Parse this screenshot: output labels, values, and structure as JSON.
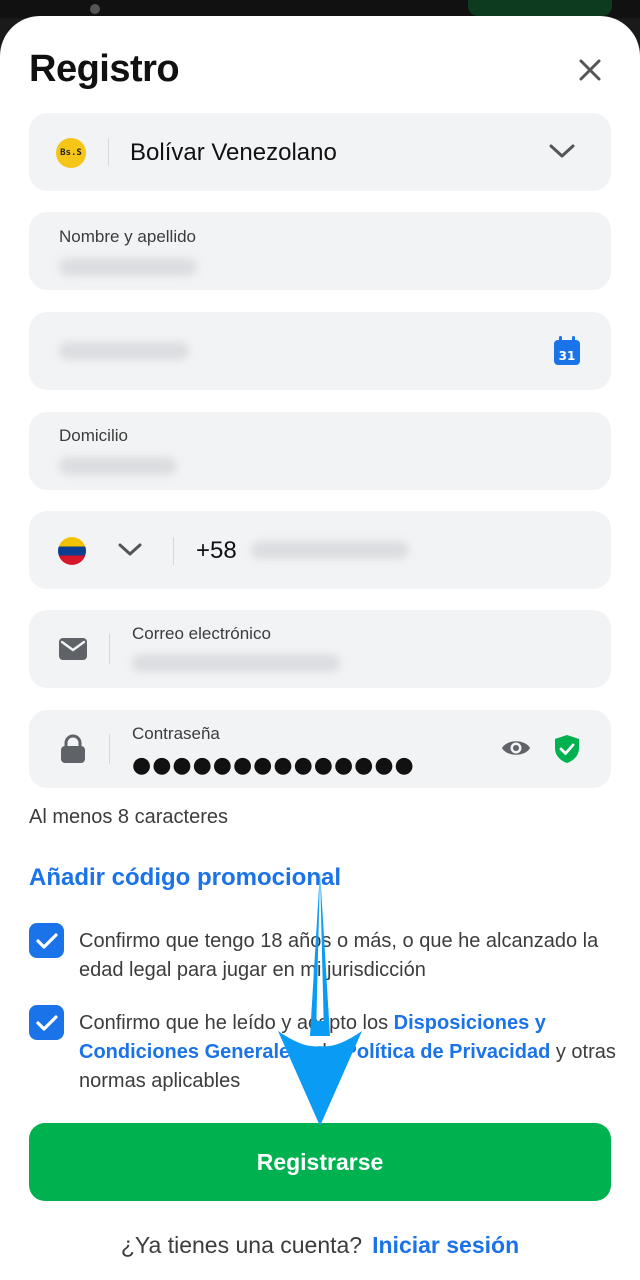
{
  "sheet": {
    "title": "Registro"
  },
  "currency": {
    "badge": "Bs.S",
    "selected": "Bolívar Venezolano"
  },
  "fields": {
    "name_label": "Nombre y apellido",
    "address_label": "Domicilio",
    "phone_code": "+58",
    "email_label": "Correo electrónico",
    "password_label": "Contraseña",
    "password_value": "●●●●●●●●●●●●●●",
    "calendar_day": "31"
  },
  "password_hint": "Al menos 8 caracteres",
  "promo_link": "Añadir código promocional",
  "consents": {
    "age_text": "Confirmo que tengo 18 años o más, o que he alcanzado la edad legal para jugar en mi jurisdicción",
    "terms_prefix": "Confirmo que he leído y acepto los ",
    "terms_link": "Disposiciones y Condiciones Generales",
    "terms_middle": " y la ",
    "privacy_link": "Política de Privacidad",
    "terms_suffix": " y otras normas aplicables"
  },
  "register_button": "Registrarse",
  "login_prompt": "¿Ya tienes una cuenta?",
  "login_link": "Iniciar sesión",
  "colors": {
    "accent_blue": "#1a73e8",
    "primary_green": "#00b14f",
    "field_bg": "#f2f3f5",
    "annotation_arrow": "#0a9cf5"
  }
}
